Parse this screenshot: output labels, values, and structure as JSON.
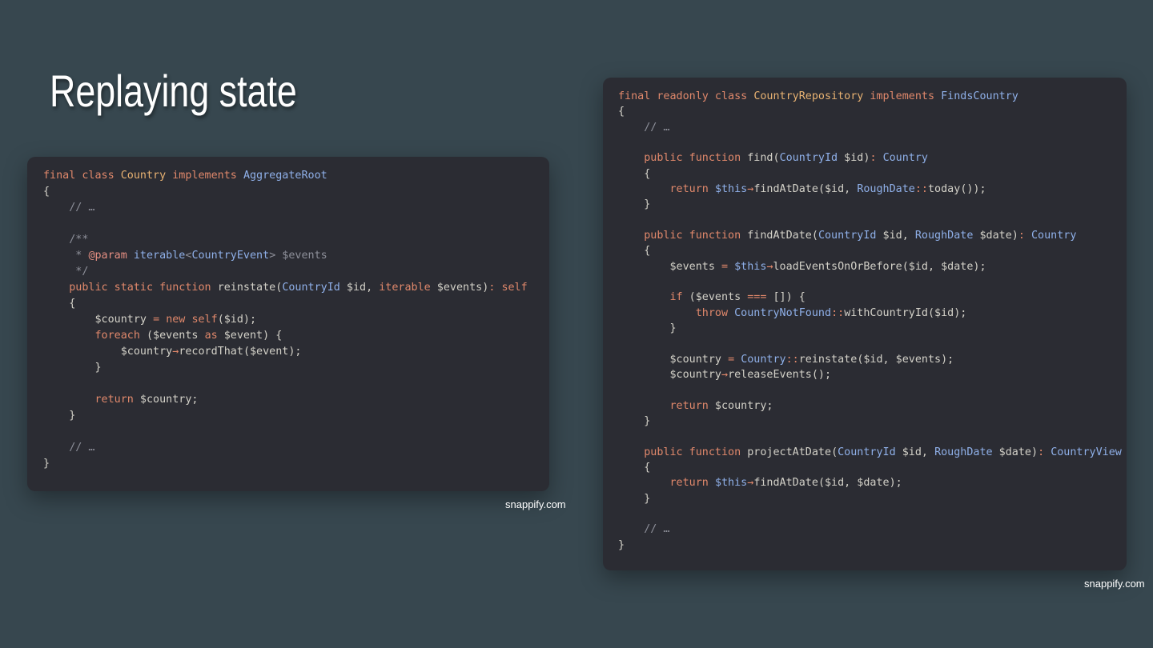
{
  "slide": {
    "title": "Replaying state"
  },
  "theme": {
    "background": "#37474f",
    "window": "#2b2c33",
    "text": "#d3d1c8",
    "keyword": "#e0886b",
    "type": "#e8b272",
    "identifier": "#8fb0e9",
    "variable": "#d3d1c8",
    "function": "#d3d1c8",
    "comment": "#8d8f99",
    "doc_tag": "#e58f82",
    "operator": "#e0886b"
  },
  "code_windows": [
    {
      "name": "country-aggregate",
      "language": "php",
      "lines": [
        [
          [
            "final class ",
            "keyword"
          ],
          [
            "Country",
            "type"
          ],
          [
            " implements ",
            "keyword"
          ],
          [
            "AggregateRoot",
            "identifier"
          ]
        ],
        [
          [
            "{",
            "plain"
          ]
        ],
        [
          [
            "    // …",
            "comment"
          ]
        ],
        [
          [
            "",
            "plain"
          ]
        ],
        [
          [
            "    /**",
            "comment"
          ]
        ],
        [
          [
            "     * ",
            "comment"
          ],
          [
            "@param",
            "doc_tag"
          ],
          [
            " iterable",
            "identifier"
          ],
          [
            "<",
            "comment"
          ],
          [
            "CountryEvent",
            "identifier"
          ],
          [
            "> $events",
            "comment"
          ]
        ],
        [
          [
            "     */",
            "comment"
          ]
        ],
        [
          [
            "    ",
            "plain"
          ],
          [
            "public static function ",
            "keyword"
          ],
          [
            "reinstate",
            "function"
          ],
          [
            "(",
            "plain"
          ],
          [
            "CountryId",
            "identifier"
          ],
          [
            " $id, ",
            "plain"
          ],
          [
            "iterable",
            "keyword"
          ],
          [
            " $events)",
            "plain"
          ],
          [
            ": ",
            "keyword"
          ],
          [
            "self",
            "keyword"
          ]
        ],
        [
          [
            "    {",
            "plain"
          ]
        ],
        [
          [
            "        $country ",
            "plain"
          ],
          [
            "= ",
            "operator"
          ],
          [
            "new ",
            "keyword"
          ],
          [
            "self",
            "keyword"
          ],
          [
            "($id);",
            "plain"
          ]
        ],
        [
          [
            "        ",
            "plain"
          ],
          [
            "foreach",
            "keyword"
          ],
          [
            " ($events ",
            "plain"
          ],
          [
            "as",
            "keyword"
          ],
          [
            " $event) {",
            "plain"
          ]
        ],
        [
          [
            "            $country",
            "plain"
          ],
          [
            "→",
            "operator"
          ],
          [
            "recordThat",
            "function"
          ],
          [
            "($event);",
            "plain"
          ]
        ],
        [
          [
            "        }",
            "plain"
          ]
        ],
        [
          [
            "",
            "plain"
          ]
        ],
        [
          [
            "        ",
            "plain"
          ],
          [
            "return",
            "keyword"
          ],
          [
            " $country;",
            "plain"
          ]
        ],
        [
          [
            "    }",
            "plain"
          ]
        ],
        [
          [
            "",
            "plain"
          ]
        ],
        [
          [
            "    // …",
            "comment"
          ]
        ],
        [
          [
            "}",
            "plain"
          ]
        ]
      ],
      "watermark": "snappify.com"
    },
    {
      "name": "country-repository",
      "language": "php",
      "lines": [
        [
          [
            "final readonly class ",
            "keyword"
          ],
          [
            "CountryRepository",
            "type"
          ],
          [
            " implements ",
            "keyword"
          ],
          [
            "FindsCountry",
            "identifier"
          ]
        ],
        [
          [
            "{",
            "plain"
          ]
        ],
        [
          [
            "    // …",
            "comment"
          ]
        ],
        [
          [
            "",
            "plain"
          ]
        ],
        [
          [
            "    ",
            "plain"
          ],
          [
            "public function ",
            "keyword"
          ],
          [
            "find",
            "function"
          ],
          [
            "(",
            "plain"
          ],
          [
            "CountryId",
            "identifier"
          ],
          [
            " $id)",
            "plain"
          ],
          [
            ": ",
            "keyword"
          ],
          [
            "Country",
            "identifier"
          ]
        ],
        [
          [
            "    {",
            "plain"
          ]
        ],
        [
          [
            "        ",
            "plain"
          ],
          [
            "return",
            "keyword"
          ],
          [
            " ",
            "plain"
          ],
          [
            "$this",
            "identifier"
          ],
          [
            "→",
            "operator"
          ],
          [
            "findAtDate",
            "function"
          ],
          [
            "($id, ",
            "plain"
          ],
          [
            "RoughDate",
            "identifier"
          ],
          [
            "::",
            "operator"
          ],
          [
            "today",
            "function"
          ],
          [
            "());",
            "plain"
          ]
        ],
        [
          [
            "    }",
            "plain"
          ]
        ],
        [
          [
            "",
            "plain"
          ]
        ],
        [
          [
            "    ",
            "plain"
          ],
          [
            "public function ",
            "keyword"
          ],
          [
            "findAtDate",
            "function"
          ],
          [
            "(",
            "plain"
          ],
          [
            "CountryId",
            "identifier"
          ],
          [
            " $id, ",
            "plain"
          ],
          [
            "RoughDate",
            "identifier"
          ],
          [
            " $date)",
            "plain"
          ],
          [
            ": ",
            "keyword"
          ],
          [
            "Country",
            "identifier"
          ]
        ],
        [
          [
            "    {",
            "plain"
          ]
        ],
        [
          [
            "        $events ",
            "plain"
          ],
          [
            "= ",
            "operator"
          ],
          [
            "$this",
            "identifier"
          ],
          [
            "→",
            "operator"
          ],
          [
            "loadEventsOnOrBefore",
            "function"
          ],
          [
            "($id, $date);",
            "plain"
          ]
        ],
        [
          [
            "",
            "plain"
          ]
        ],
        [
          [
            "        ",
            "plain"
          ],
          [
            "if",
            "keyword"
          ],
          [
            " ($events ",
            "plain"
          ],
          [
            "===",
            "operator"
          ],
          [
            " []) {",
            "plain"
          ]
        ],
        [
          [
            "            ",
            "plain"
          ],
          [
            "throw",
            "keyword"
          ],
          [
            " ",
            "plain"
          ],
          [
            "CountryNotFound",
            "identifier"
          ],
          [
            "::",
            "operator"
          ],
          [
            "withCountryId",
            "function"
          ],
          [
            "($id);",
            "plain"
          ]
        ],
        [
          [
            "        }",
            "plain"
          ]
        ],
        [
          [
            "",
            "plain"
          ]
        ],
        [
          [
            "        $country ",
            "plain"
          ],
          [
            "= ",
            "operator"
          ],
          [
            "Country",
            "identifier"
          ],
          [
            "::",
            "operator"
          ],
          [
            "reinstate",
            "function"
          ],
          [
            "($id, $events);",
            "plain"
          ]
        ],
        [
          [
            "        $country",
            "plain"
          ],
          [
            "→",
            "operator"
          ],
          [
            "releaseEvents",
            "function"
          ],
          [
            "();",
            "plain"
          ]
        ],
        [
          [
            "",
            "plain"
          ]
        ],
        [
          [
            "        ",
            "plain"
          ],
          [
            "return",
            "keyword"
          ],
          [
            " $country;",
            "plain"
          ]
        ],
        [
          [
            "    }",
            "plain"
          ]
        ],
        [
          [
            "",
            "plain"
          ]
        ],
        [
          [
            "    ",
            "plain"
          ],
          [
            "public function ",
            "keyword"
          ],
          [
            "projectAtDate",
            "function"
          ],
          [
            "(",
            "plain"
          ],
          [
            "CountryId",
            "identifier"
          ],
          [
            " $id, ",
            "plain"
          ],
          [
            "RoughDate",
            "identifier"
          ],
          [
            " $date)",
            "plain"
          ],
          [
            ": ",
            "keyword"
          ],
          [
            "CountryView",
            "identifier"
          ]
        ],
        [
          [
            "    {",
            "plain"
          ]
        ],
        [
          [
            "        ",
            "plain"
          ],
          [
            "return",
            "keyword"
          ],
          [
            " ",
            "plain"
          ],
          [
            "$this",
            "identifier"
          ],
          [
            "→",
            "operator"
          ],
          [
            "findAtDate",
            "function"
          ],
          [
            "($id, $date);",
            "plain"
          ]
        ],
        [
          [
            "    }",
            "plain"
          ]
        ],
        [
          [
            "",
            "plain"
          ]
        ],
        [
          [
            "    // …",
            "comment"
          ]
        ],
        [
          [
            "}",
            "plain"
          ]
        ]
      ],
      "watermark": "snappify.com"
    }
  ]
}
